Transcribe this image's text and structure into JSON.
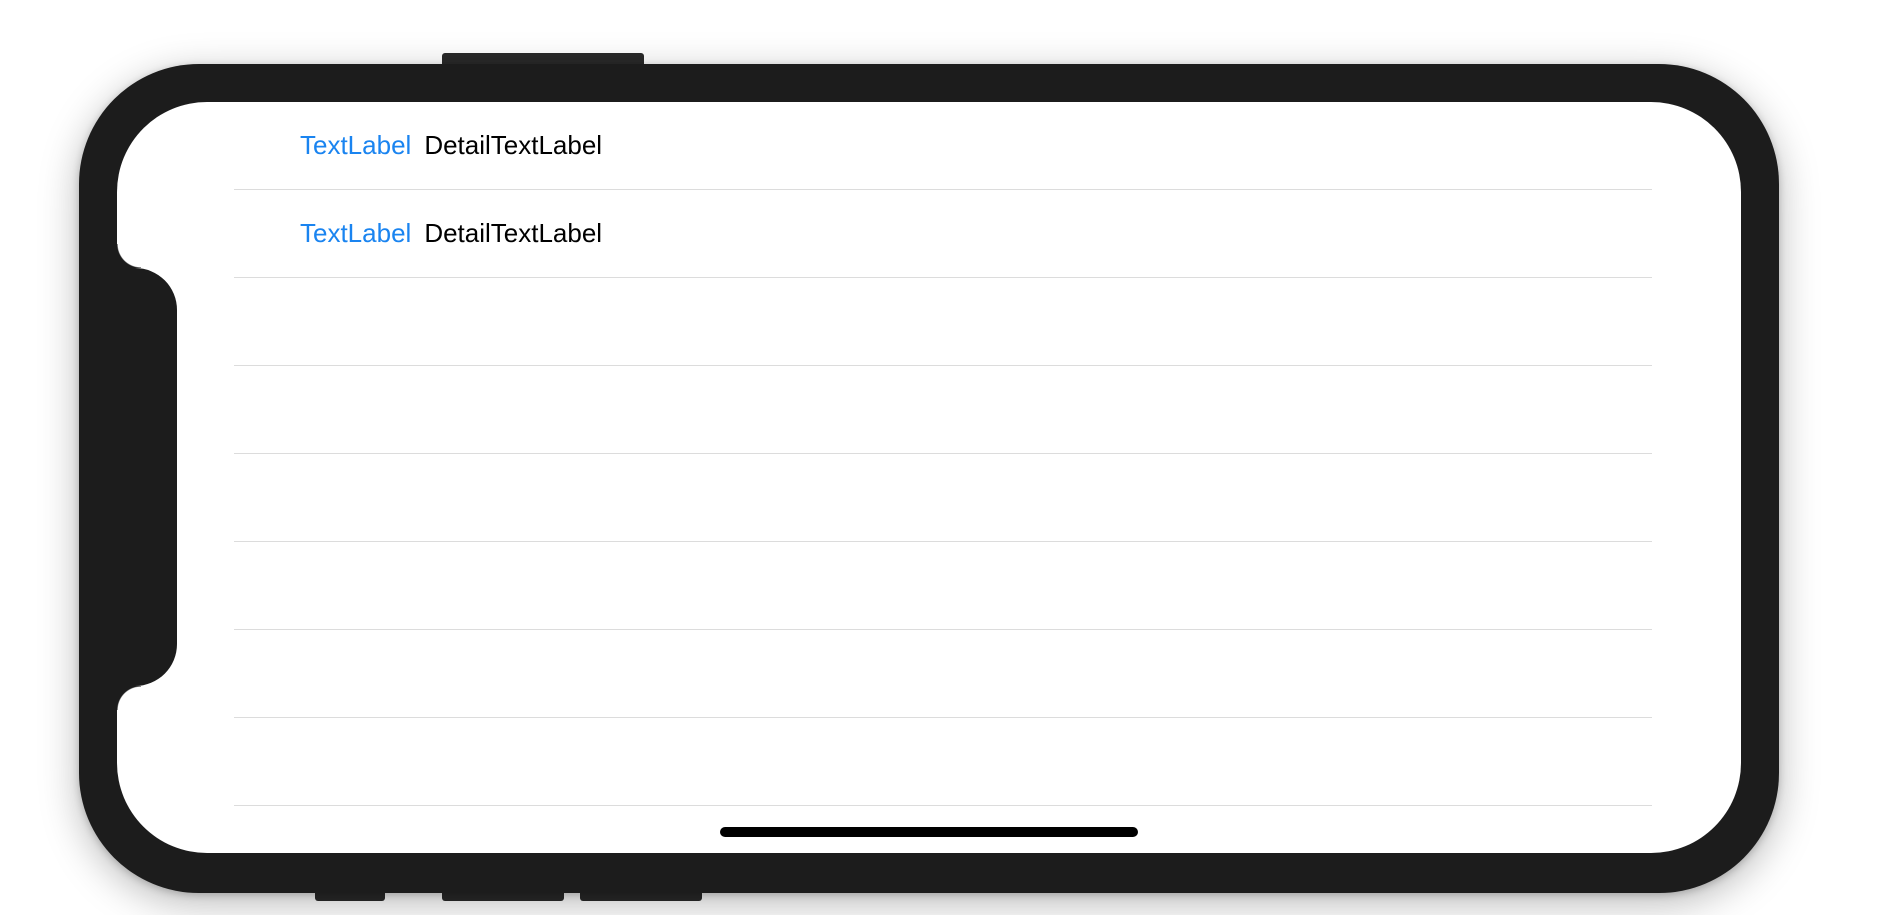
{
  "table": {
    "rows": [
      {
        "text_label": "TextLabel",
        "detail_label": "DetailTextLabel"
      },
      {
        "text_label": "TextLabel",
        "detail_label": "DetailTextLabel"
      },
      {
        "text_label": "",
        "detail_label": ""
      },
      {
        "text_label": "",
        "detail_label": ""
      },
      {
        "text_label": "",
        "detail_label": ""
      },
      {
        "text_label": "",
        "detail_label": ""
      },
      {
        "text_label": "",
        "detail_label": ""
      },
      {
        "text_label": "",
        "detail_label": ""
      }
    ]
  },
  "colors": {
    "text_label": "#1a84f0",
    "detail_label": "#000000",
    "separator": "#dcdcdc",
    "device_frame": "#1c1c1c"
  }
}
